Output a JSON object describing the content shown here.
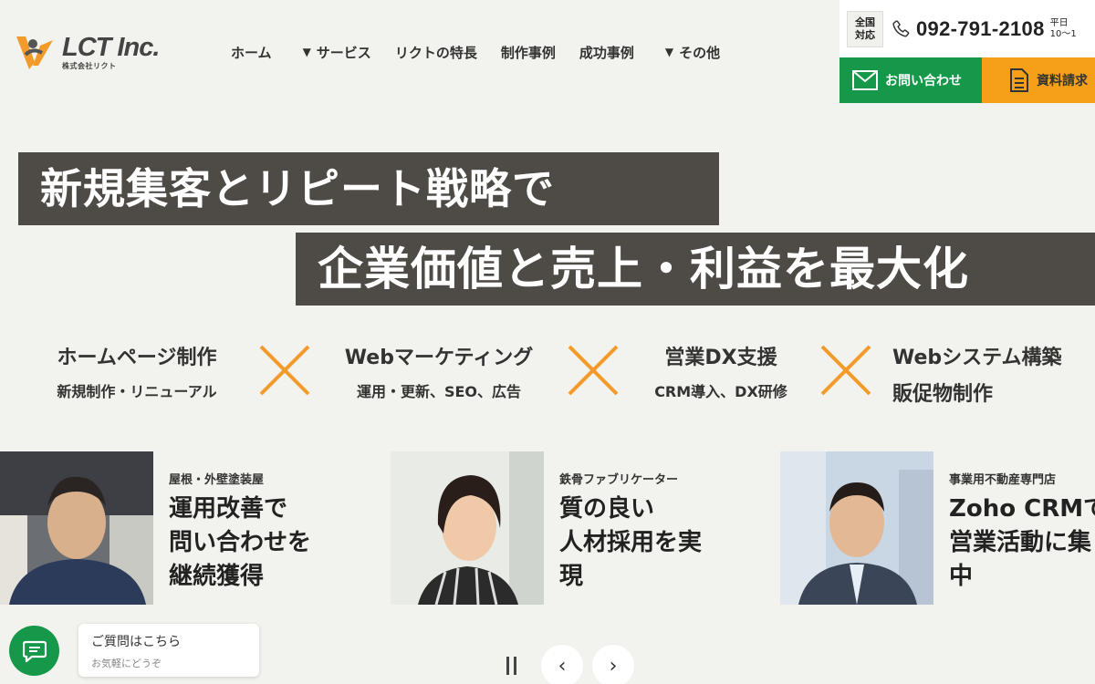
{
  "header": {
    "logo": {
      "name": "LCT Inc.",
      "sub": "株式会社リクト"
    },
    "nav": [
      {
        "label": "ホーム",
        "dropdown": false
      },
      {
        "label": "サービス",
        "dropdown": true
      },
      {
        "label": "リクトの特長",
        "dropdown": false
      },
      {
        "label": "制作事例",
        "dropdown": false
      },
      {
        "label": "成功事例",
        "dropdown": false
      },
      {
        "label": "その他",
        "dropdown": true
      }
    ],
    "contact": {
      "nationwide_line1": "全国",
      "nationwide_line2": "対応",
      "phone": "092-791-2108",
      "hours_line1": "平日",
      "hours_line2": "10〜1",
      "inquiry_label": "お問い合わせ",
      "docs_label": "資料請求"
    }
  },
  "hero": {
    "line1": "新規集客とリピート戦略で",
    "line2": "企業価値と売上・利益を最大化"
  },
  "services": [
    {
      "title": "ホームページ制作",
      "sub": "新規制作・リニューアル"
    },
    {
      "title": "Webマーケティング",
      "sub": "運用・更新、SEO、広告"
    },
    {
      "title": "営業DX支援",
      "sub": "CRM導入、DX研修"
    },
    {
      "title": "Webシステム構築",
      "sub": "販促物制作"
    }
  ],
  "cards": [
    {
      "category": "屋根・外壁塗装屋",
      "headline": [
        "運用改善で",
        "問い合わせを",
        "継続獲得"
      ]
    },
    {
      "category": "鉄骨ファブリケーター",
      "headline": [
        "質の良い",
        "人材採用を実",
        "現"
      ]
    },
    {
      "category": "事業用不動産専門店",
      "headline": [
        "Zoho CRMで",
        "営業活動に集",
        "中"
      ]
    }
  ],
  "chat": {
    "title": "ご質問はこちら",
    "sub": "お気軽にどうぞ"
  },
  "slider": {
    "prev": "‹",
    "next": "›"
  },
  "colors": {
    "accent_green": "#15984a",
    "accent_orange": "#f5a018",
    "hero_bg": "#4e4a46",
    "cross_orange": "#f39b2a"
  }
}
